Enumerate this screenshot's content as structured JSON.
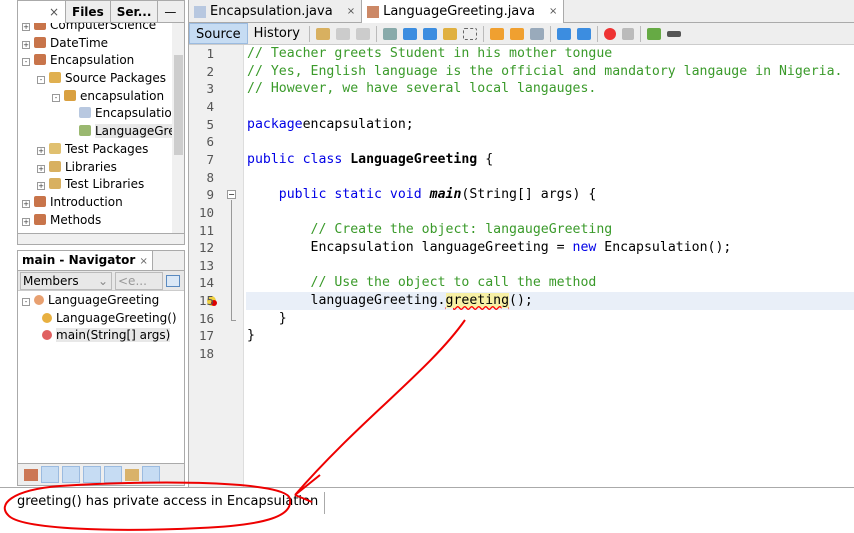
{
  "projects": {
    "tabs": [
      "Files",
      "Ser..."
    ],
    "close": "×",
    "minimize": "—",
    "tree": [
      {
        "label": "ComputerScience",
        "depth": 0,
        "exp": "+",
        "icon": "java-project-icon"
      },
      {
        "label": "DateTime",
        "depth": 0,
        "exp": "+",
        "icon": "java-project-icon"
      },
      {
        "label": "Encapsulation",
        "depth": 0,
        "exp": "-",
        "icon": "java-project-error-icon"
      },
      {
        "label": "Source Packages",
        "depth": 1,
        "exp": "-",
        "icon": "source-packages-icon"
      },
      {
        "label": "encapsulation",
        "depth": 2,
        "exp": "-",
        "icon": "package-icon"
      },
      {
        "label": "Encapsulatio",
        "depth": 3,
        "exp": "",
        "icon": "java-file-icon"
      },
      {
        "label": "LanguageGre",
        "depth": 3,
        "exp": "",
        "icon": "java-main-file-icon",
        "selected": true
      },
      {
        "label": "Test Packages",
        "depth": 1,
        "exp": "+",
        "icon": "test-packages-icon"
      },
      {
        "label": "Libraries",
        "depth": 1,
        "exp": "+",
        "icon": "libraries-icon"
      },
      {
        "label": "Test Libraries",
        "depth": 1,
        "exp": "+",
        "icon": "test-libraries-icon"
      },
      {
        "label": "Introduction",
        "depth": 0,
        "exp": "+",
        "icon": "java-project-icon"
      },
      {
        "label": "Methods",
        "depth": 0,
        "exp": "+",
        "icon": "java-project-icon"
      }
    ]
  },
  "navigator": {
    "title": "main - Navigator",
    "close": "×",
    "filter": "Members",
    "filter2": "<e...",
    "tree": [
      {
        "label": "LanguageGreeting",
        "depth": 0
      },
      {
        "label": "LanguageGreeting()",
        "depth": 1
      },
      {
        "label": "main(String[] args)",
        "depth": 1,
        "selected": true
      }
    ]
  },
  "editor": {
    "tabs": [
      {
        "label": "Encapsulation.java",
        "selected": false
      },
      {
        "label": "LanguageGreeting.java",
        "selected": true
      }
    ],
    "close": "×",
    "views": [
      "Source",
      "History"
    ],
    "lines": [
      [
        [
          "cm",
          "// Teacher greets Student in his mother tongue"
        ]
      ],
      [
        [
          "cm",
          "// Yes, English language is the official and mandatory langauge in Nigeria."
        ]
      ],
      [
        [
          "cm",
          "// However, we have several local langauges."
        ]
      ],
      [],
      [
        [
          "kw",
          "package"
        ],
        [
          "",
          "encapsulation;"
        ]
      ],
      [],
      [
        [
          "kw",
          "public class "
        ],
        [
          "b",
          "LanguageGreeting"
        ],
        [
          "",
          " {"
        ]
      ],
      [],
      [
        [
          "",
          "    "
        ],
        [
          "kw",
          "public static void "
        ],
        [
          "i",
          "main"
        ],
        [
          "",
          "(String[] args) {"
        ]
      ],
      [],
      [
        [
          "",
          "        "
        ],
        [
          "cm",
          "// Create the object: langaugeGreeting"
        ]
      ],
      [
        [
          "",
          "        Encapsulation languageGreeting = "
        ],
        [
          "kw",
          "new"
        ],
        [
          "",
          " Encapsulation();"
        ]
      ],
      [],
      [
        [
          "",
          "        "
        ],
        [
          "cm",
          "// Use the object to call the method"
        ]
      ],
      [
        [
          "",
          "        languageGreeting."
        ],
        [
          "err",
          "greeting"
        ],
        [
          "",
          "();"
        ]
      ],
      [
        [
          "",
          "    }"
        ]
      ],
      [
        [
          "",
          "}"
        ]
      ],
      []
    ],
    "highlight_line": 15,
    "error_line": 15
  },
  "status": {
    "message": "greeting() has private access in Encapsulation"
  },
  "colors": {
    "comment": "#3a9a2a",
    "keyword": "#0000e6",
    "annotation": "#e00000",
    "selected_tab": "#c6dcf3"
  }
}
